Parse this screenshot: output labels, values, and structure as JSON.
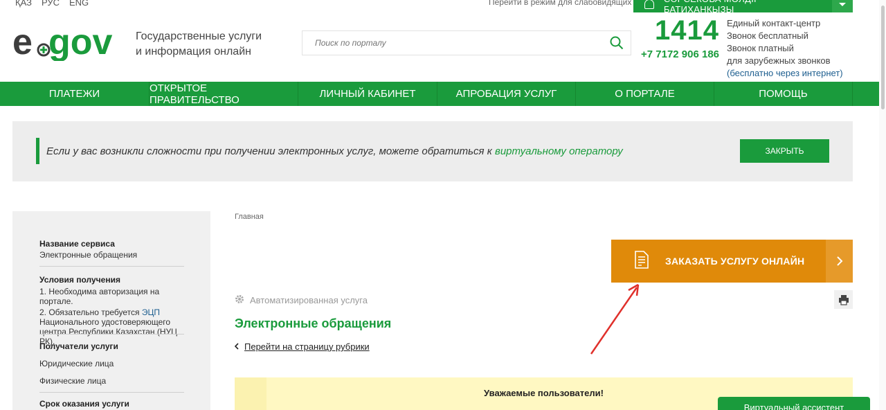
{
  "languages": [
    "ҚАЗ",
    "РУС",
    "ENG"
  ],
  "header": {
    "low_vision_link": "Перейти в режим для слабовидящих",
    "user_name": "СӘРСЕКОВА МӨЛДІР БАТИХАНҚЫЗЫ",
    "logo_text": "egov",
    "tagline_line1": "Государственные услуги",
    "tagline_line2": "и информация онлайн",
    "search_placeholder": "Поиск по порталу",
    "contact_number": "1414",
    "contact_phone": "+7 7172 906 186",
    "contact_line1": "Единый контакт-центр",
    "contact_line2": "Звонок бесплатный",
    "contact_line3": "Звонок платный",
    "contact_line4": "для зарубежных звонков",
    "contact_line5": "(бесплатно через интернет)"
  },
  "nav": [
    {
      "label": "ПЛАТЕЖИ"
    },
    {
      "label": "ОТКРЫТОЕ ПРАВИТЕЛЬСТВО"
    },
    {
      "label": "ЛИЧНЫЙ КАБИНЕТ"
    },
    {
      "label": "АПРОБАЦИЯ УСЛУГ"
    },
    {
      "label": "О ПОРТАЛЕ"
    },
    {
      "label": "ПОМОЩЬ"
    }
  ],
  "notice": {
    "text": "Если у вас возникли сложности при получении электронных услуг, можете обратиться к ",
    "link": "виртуальному оператору",
    "close_label": "ЗАКРЫТЬ"
  },
  "sidebar": {
    "service_name_title": "Название сервиса",
    "service_name_value": "Электронные обращения",
    "conditions_title": "Условия получения",
    "condition_1": "1. Необходима авторизация на портале.",
    "condition_2_prefix": "2. Обязательно требуется ",
    "condition_2_link": "ЭЦП",
    "condition_2_suffix": "Национального удостоверяющего центра Республики Казахстан (НУЦ РК).",
    "recipients_title": "Получатели услуги",
    "recipient_1": "Юридические лица",
    "recipient_2": "Физические лица",
    "term_title": "Срок оказания услуги"
  },
  "main": {
    "breadcrumb": "Главная",
    "order_button": "ЗАКАЗАТЬ УСЛУГУ ОНЛАЙН",
    "automated_label": "Автоматизированная услуга",
    "title": "Электронные обращения",
    "rubric_link": "Перейти на страницу рубрики",
    "warning_title": "Уважаемые пользователи!"
  },
  "assistant_label": "Виртуальный ассистент",
  "colors": {
    "brand_green": "#1a9b3c",
    "order_orange": "#e08a0a",
    "annotation_red": "#e0302b"
  }
}
